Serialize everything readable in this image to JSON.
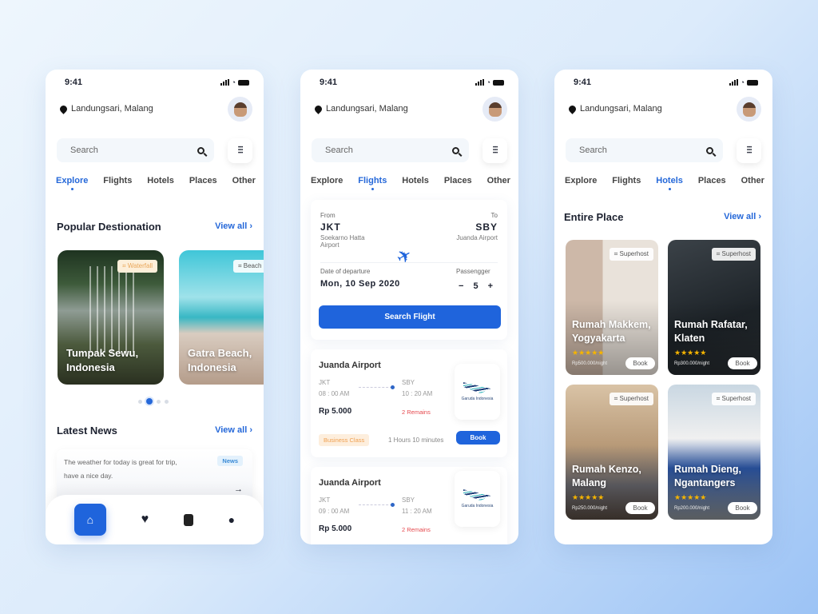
{
  "status": {
    "time": "9:41"
  },
  "header": {
    "location": "Landungsari, Malang",
    "search_placeholder": "Search"
  },
  "tabs": [
    "Explore",
    "Flights",
    "Hotels",
    "Places",
    "Other"
  ],
  "explore": {
    "popular_title": "Popular Destionation",
    "view_all": "View all",
    "destinations": [
      {
        "name": "Tumpak Sewu, Indonesia",
        "tag": "Waterfall"
      },
      {
        "name": "Gatra Beach, Indonesia",
        "tag": "Beach"
      }
    ],
    "carousel": {
      "count": 4,
      "active": 1
    },
    "news_title": "Latest News",
    "news": {
      "text": "The weather for today is great for trip, have a nice day.",
      "badge": "News"
    },
    "nav": [
      "home",
      "favorites",
      "bookings",
      "profile"
    ]
  },
  "flights": {
    "from_label": "From",
    "to_label": "To",
    "from_code": "JKT",
    "to_code": "SBY",
    "from_airport": "Soekarno Hatta Airport",
    "to_airport": "Juanda Airport",
    "date_label": "Date of departure",
    "date": "Mon, 10 Sep 2020",
    "passenger_label": "Passengger",
    "passengers": "5",
    "minus": "−",
    "plus": "+",
    "search_button": "Search Flight",
    "results": [
      {
        "airport": "Juanda Airport",
        "from": "JKT",
        "to": "SBY",
        "depart": "08 : 00 AM",
        "arrive": "10 : 20 AM",
        "price": "Rp 5.000",
        "remains": "2 Remains",
        "class": "Business Class",
        "duration": "1 Hours 10 minutes",
        "book": "Book",
        "airline": "Garuda Indonesia"
      },
      {
        "airport": "Juanda Airport",
        "from": "JKT",
        "to": "SBY",
        "depart": "09 : 00 AM",
        "arrive": "11 : 20 AM",
        "price": "Rp 5.000",
        "remains": "2 Remains",
        "airline": "Garuda Indonesia"
      }
    ]
  },
  "hotels": {
    "title": "Entire Place",
    "view_all": "View all",
    "badge": "Superhost",
    "book": "Book",
    "rating": 5,
    "items": [
      {
        "name": "Rumah Makkem, Yogyakarta",
        "price": "Rp500.000/night"
      },
      {
        "name": "Rumah Rafatar, Klaten",
        "price": "Rp300.000/night"
      },
      {
        "name": "Rumah Kenzo, Malang",
        "price": "Rp250.000/night"
      },
      {
        "name": "Rumah Dieng, Ngantangers",
        "price": "Rp200.000/night"
      }
    ]
  },
  "colors": {
    "accent": "#1f64dc",
    "remains": "#e5484d",
    "business_bg": "#fdeedd",
    "business_fg": "#f0a050",
    "star": "#f5b400"
  }
}
